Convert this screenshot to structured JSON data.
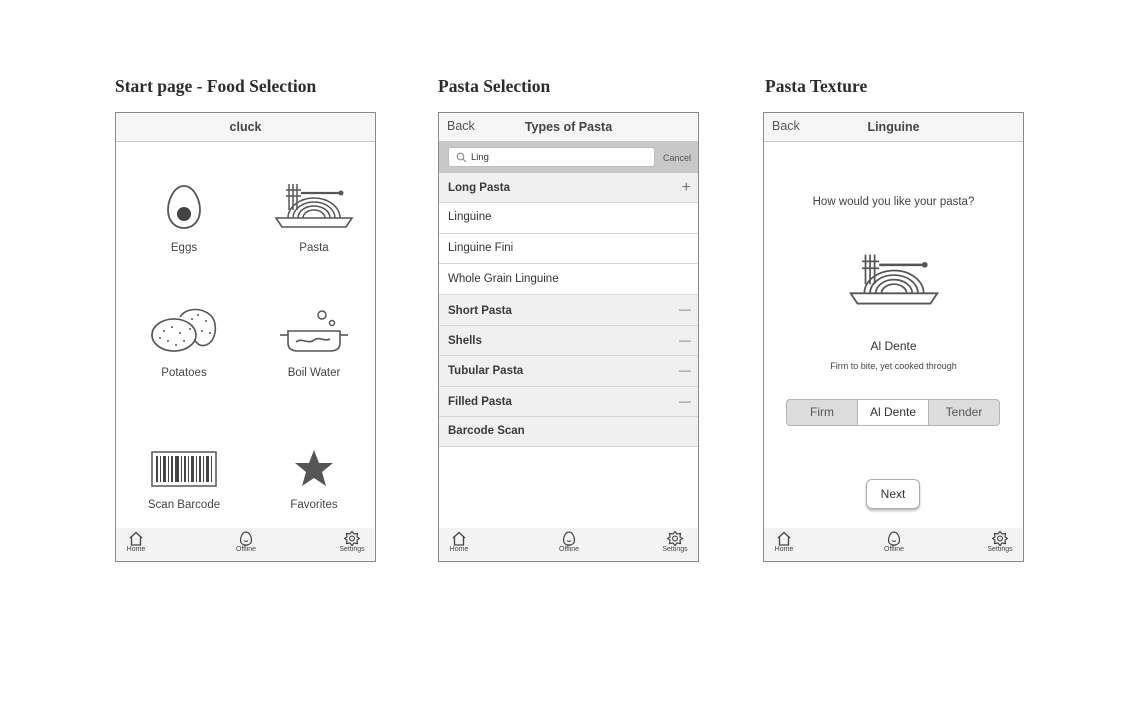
{
  "captions": {
    "screen1": "Start page - Food Selection",
    "screen2": "Pasta Selection",
    "screen3": "Pasta Texture"
  },
  "tabbar": {
    "home": "Home",
    "offline": "Offline",
    "settings": "Settings"
  },
  "screen1": {
    "title": "cluck",
    "items": [
      {
        "label": "Eggs",
        "icon": "egg-icon"
      },
      {
        "label": "Pasta",
        "icon": "pasta-icon"
      },
      {
        "label": "Potatoes",
        "icon": "potatoes-icon"
      },
      {
        "label": "Boil Water",
        "icon": "boil-water-icon"
      },
      {
        "label": "Scan Barcode",
        "icon": "barcode-icon"
      },
      {
        "label": "Favorites",
        "icon": "star-icon"
      }
    ]
  },
  "screen2": {
    "back": "Back",
    "title": "Types of Pasta",
    "search": {
      "value": "Ling",
      "cancel": "Cancel",
      "icon": "search-icon"
    },
    "sections": [
      {
        "label": "Long Pasta",
        "control": "+",
        "expanded": true
      },
      {
        "label": "Short Pasta",
        "control": "—",
        "expanded": false
      },
      {
        "label": "Shells",
        "control": "—",
        "expanded": false
      },
      {
        "label": "Tubular Pasta",
        "control": "—",
        "expanded": false
      },
      {
        "label": "Filled Pasta",
        "control": "—",
        "expanded": false
      },
      {
        "label": "Barcode Scan",
        "control": "",
        "expanded": false
      }
    ],
    "long_pasta_items": [
      "Linguine",
      "Linguine Fini",
      "Whole Grain Linguine"
    ]
  },
  "screen3": {
    "back": "Back",
    "title": "Linguine",
    "question": "How would you like your pasta?",
    "texture_title": "Al Dente",
    "texture_desc": "Firm to bite, yet cooked through",
    "segments": [
      "Firm",
      "Al Dente",
      "Tender"
    ],
    "selected_segment": "Al Dente",
    "next": "Next"
  },
  "colors": {
    "frame_border": "#8a8a8a",
    "icon_fill": "#555555",
    "search_bar_bg": "#c8c8c8",
    "section_bg": "#f0f0f0"
  }
}
